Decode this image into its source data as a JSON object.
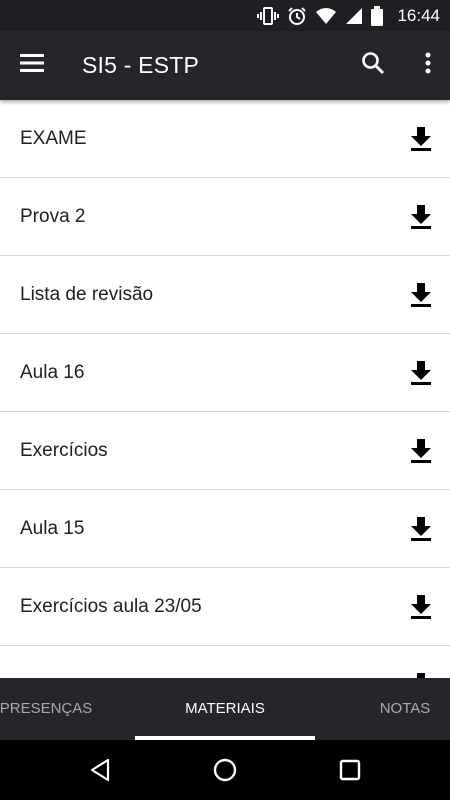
{
  "status_bar": {
    "time": "16:44",
    "icons": [
      "vibrate-icon",
      "alarm-icon",
      "wifi-icon",
      "signal-icon",
      "battery-icon"
    ]
  },
  "app_bar": {
    "title": "SI5 - ESTP",
    "icons": [
      "menu-icon",
      "search-icon",
      "more-vert-icon"
    ]
  },
  "materials": {
    "items": [
      {
        "label": "EXAME"
      },
      {
        "label": "Prova 2"
      },
      {
        "label": "Lista de revisão"
      },
      {
        "label": "Aula 16"
      },
      {
        "label": "Exercícios"
      },
      {
        "label": "Aula 15"
      },
      {
        "label": "Exercícios aula 23/05"
      },
      {
        "label": ""
      }
    ],
    "item_icon": "download-icon"
  },
  "tabs": [
    {
      "label": "PRESENÇAS",
      "selected": false
    },
    {
      "label": "MATERIAIS",
      "selected": true
    },
    {
      "label": "NOTAS",
      "selected": false
    }
  ],
  "nav_bar": {
    "icons": [
      "back-icon",
      "home-icon",
      "recents-icon"
    ]
  },
  "colors": {
    "app_bar": "#24262b",
    "status_bar": "#1d1f23",
    "tab_bar": "#24262b",
    "tab_inactive_text": "#a9abae",
    "indicator": "#ffffff"
  }
}
